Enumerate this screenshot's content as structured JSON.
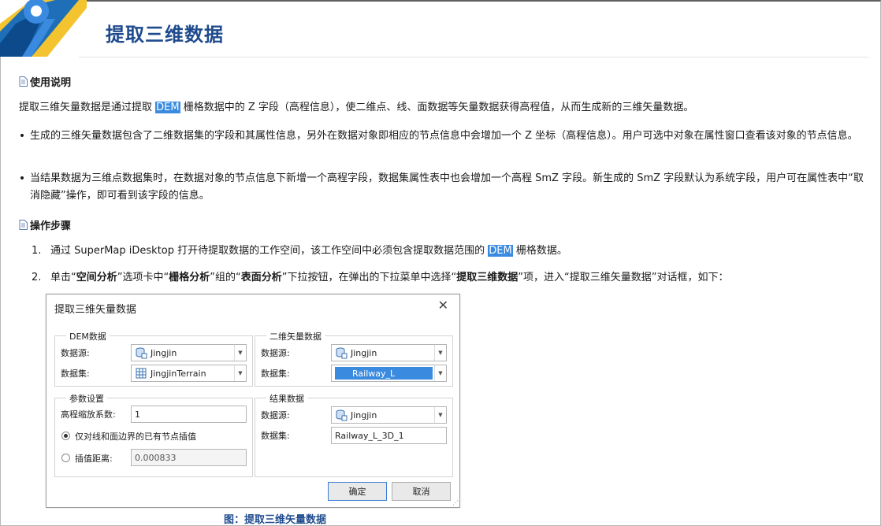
{
  "page": {
    "title": "提取三维数据",
    "section_usage": "使用说明",
    "intro_before": "提取三维矢量数据是通过提取",
    "dem": "DEM",
    "intro_after": "栅格数据中的 Z 字段（高程信息），使二维点、线、面数据等矢量数据获得高程值，从而生成新的三维矢量数据。",
    "bullet_1": "生成的三维矢量数据包含了二维数据集的字段和其属性信息，另外在数据对象即相应的节点信息中会增加一个 Z 坐标（高程信息）。用户可选中对象在属性窗口查看该对象的节点信息。",
    "bullet_2": "当结果数据为三维点数据集时，在数据对象的节点信息下新增一个高程字段，数据集属性表中也会增加一个高程 SmZ 字段。新生成的 SmZ 字段默认为系统字段，用户可在属性表中“取消隐藏”操作，即可看到该字段的信息。",
    "section_steps": "操作步骤",
    "step1_num": "1.",
    "step1_before": "通过 SuperMap iDesktop 打开待提取数据的工作空间，该工作空间中必须包含提取数据范围的",
    "step1_after": "栅格数据。",
    "step2_num": "2.",
    "step2_p1": "单击“",
    "step2_b1": "空间分析",
    "step2_p2": "”选项卡中“",
    "step2_b2": "栅格分析",
    "step2_p3": "”组的“",
    "step2_b3": "表面分析",
    "step2_p4": "”下拉按钮，在弹出的下拉菜单中选择“",
    "step2_b4": "提取三维数据",
    "step2_p5": "”项，进入“提取三维矢量数据”对话框，如下：",
    "caption": "图：提取三维矢量数据"
  },
  "dialog": {
    "title": "提取三维矢量数据",
    "close": "✕",
    "dem_group": "DEM数据",
    "datasource_label": "数据源:",
    "dataset_label": "数据集:",
    "dem_datasource": "Jingjin",
    "dem_dataset": "JingjinTerrain",
    "vec_group": "二维矢量数据",
    "vec_datasource": "Jingjin",
    "vec_dataset": "Railway_L",
    "params_group": "参数设置",
    "scale_label": "高程缩放系数:",
    "scale_value": "1",
    "radio1": "仅对线和面边界的已有节点插值",
    "radio2": "插值距离:",
    "interp_value": "0.000833",
    "result_group": "结果数据",
    "res_datasource": "Jingjin",
    "res_dataset": "Railway_L_3D_1",
    "ok": "确定",
    "cancel": "取消"
  },
  "colors": {
    "title": "#1f4b8e",
    "highlight": "#3a8be0"
  }
}
